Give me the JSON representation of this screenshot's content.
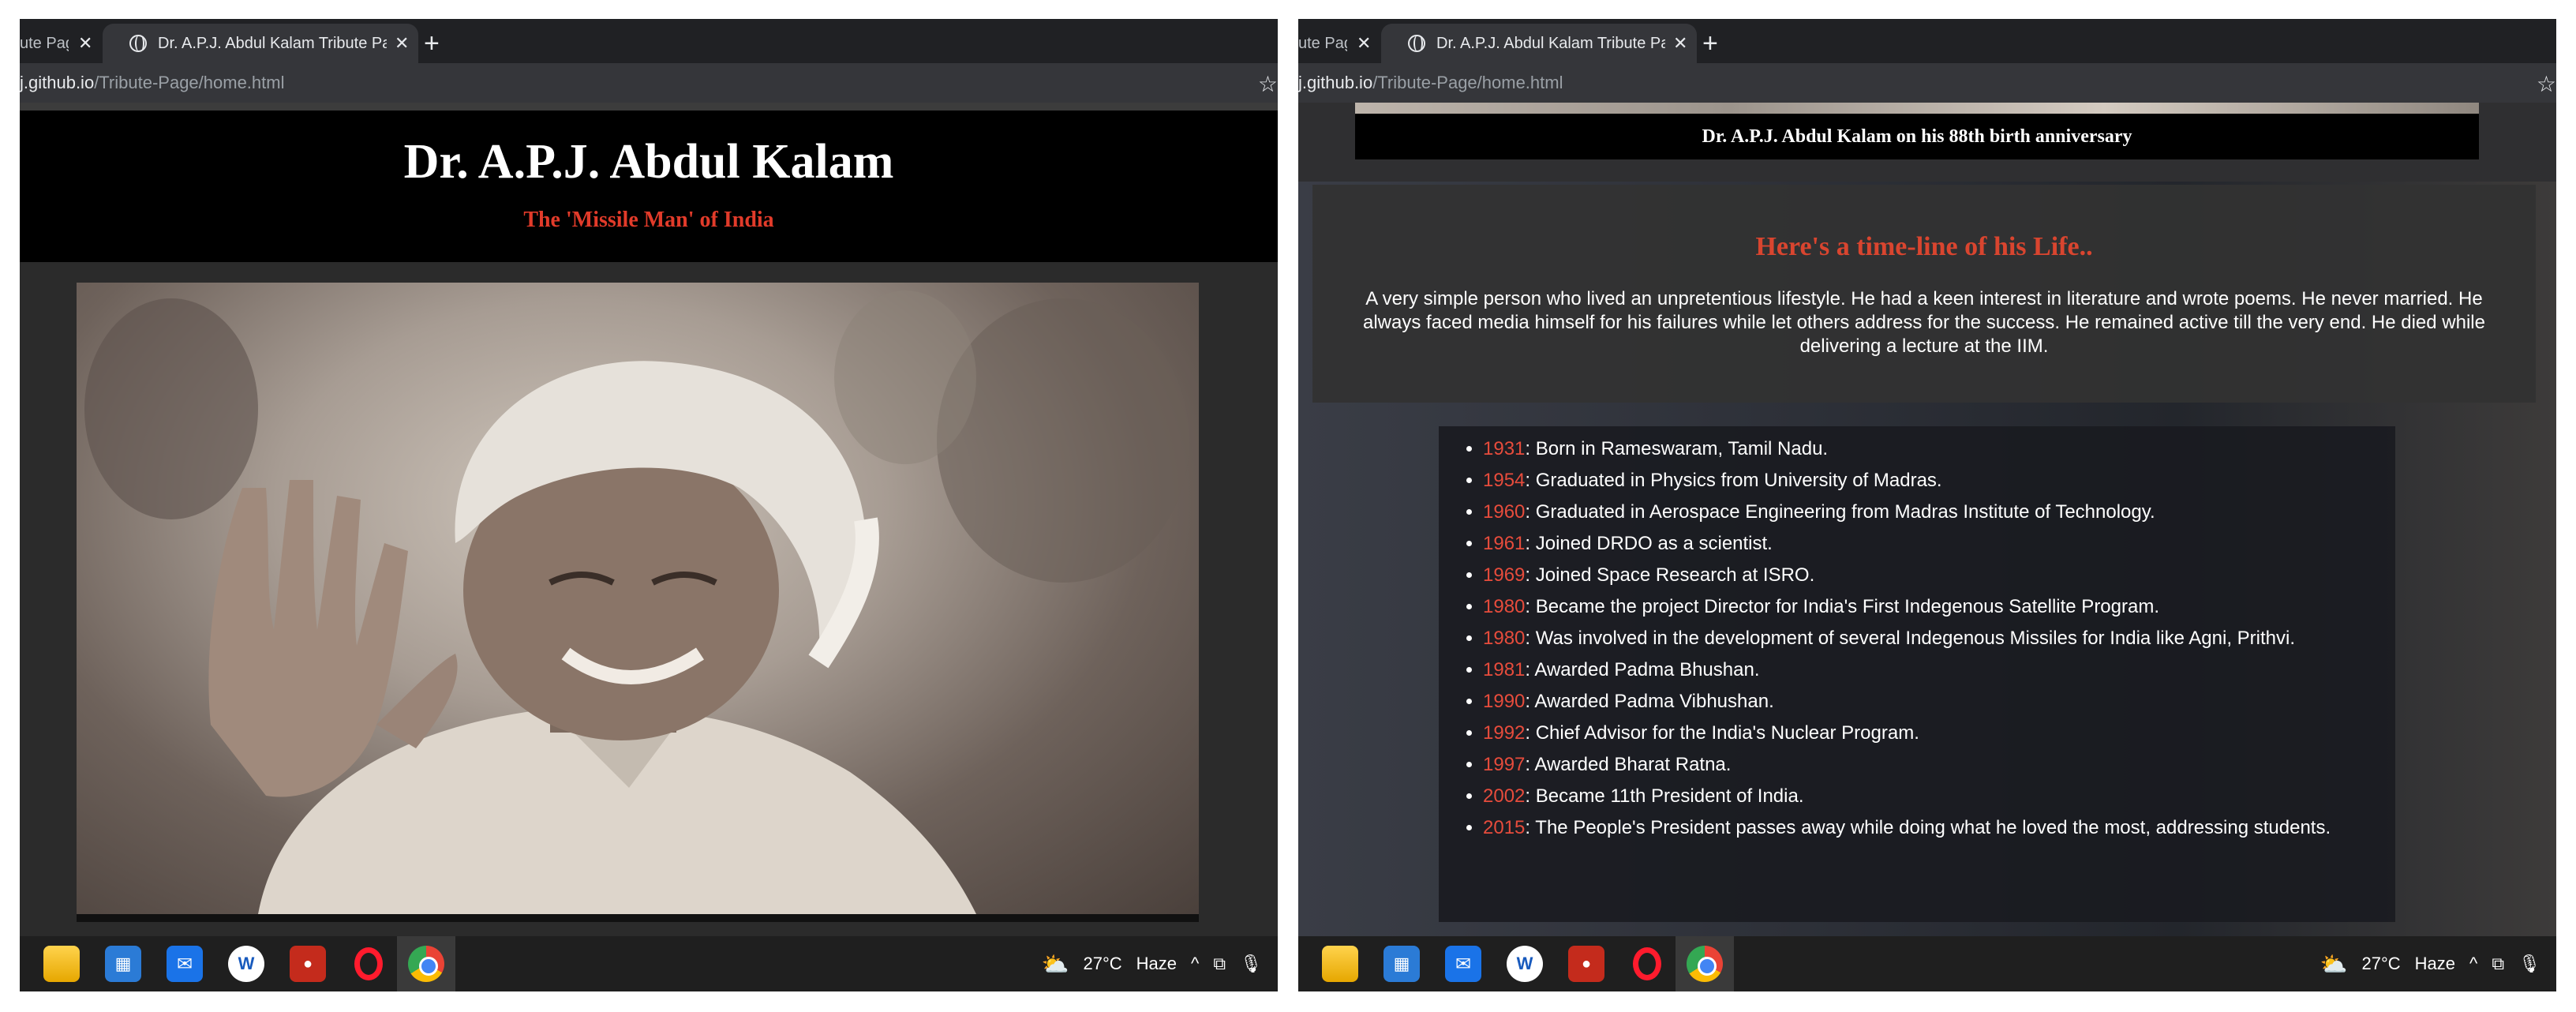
{
  "browser": {
    "prev_tab_title": "ute Pag",
    "active_tab_title": "Dr. A.P.J. Abdul Kalam Tribute Pag",
    "tab_close": "✕",
    "new_tab": "+",
    "url_host": "j.github.io",
    "url_path": "/Tribute-Page/home.html",
    "star": "☆"
  },
  "left_page": {
    "title": "Dr. A.P.J. Abdul Kalam",
    "subtitle": "The 'Missile Man' of India"
  },
  "right_page": {
    "caption": "Dr. A.P.J. Abdul Kalam on his 88th birth anniversary",
    "bio_heading": "Here's a time-line of his Life..",
    "bio_text": "A very simple person who lived an unpretentious lifestyle. He had a keen interest in literature and wrote poems. He never married. He always faced media himself for his failures while let others address for the success. He remained active till the very end. He died while delivering a lecture at the IIM.",
    "timeline": [
      {
        "year": "1931",
        "text": ": Born in Rameswaram, Tamil Nadu."
      },
      {
        "year": "1954",
        "text": ": Graduated in Physics from University of Madras."
      },
      {
        "year": "1960",
        "text": ": Graduated in Aerospace Engineering from Madras Institute of Technology."
      },
      {
        "year": "1961",
        "text": ": Joined DRDO as a scientist."
      },
      {
        "year": "1969",
        "text": ": Joined Space Research at ISRO."
      },
      {
        "year": "1980",
        "text": ": Became the project Director for India's First Indegenous Satellite Program."
      },
      {
        "year": "1980",
        "text": ": Was involved in the development of several Indegenous Missiles for India like Agni, Prithvi."
      },
      {
        "year": "1981",
        "text": ": Awarded Padma Bhushan."
      },
      {
        "year": "1990",
        "text": ": Awarded Padma Vibhushan."
      },
      {
        "year": "1992",
        "text": ": Chief Advisor for the India's Nuclear Program."
      },
      {
        "year": "1997",
        "text": ": Awarded Bharat Ratna."
      },
      {
        "year": "2002",
        "text": ": Became 11th President of India."
      },
      {
        "year": "2015",
        "text": ": The People's President passes away while doing what he loved the most, addressing students."
      }
    ]
  },
  "taskbar": {
    "icons": [
      "file-explorer-icon",
      "microsoft-store-icon",
      "mail-icon",
      "word-icon",
      "recorder-icon",
      "opera-icon",
      "chrome-icon"
    ],
    "temperature": "27°C",
    "weather": "Haze",
    "chevron": "^"
  },
  "colors": {
    "accent_red": "#e23b2a",
    "timeline_year": "#e74c3c",
    "header_bg": "#000000"
  }
}
